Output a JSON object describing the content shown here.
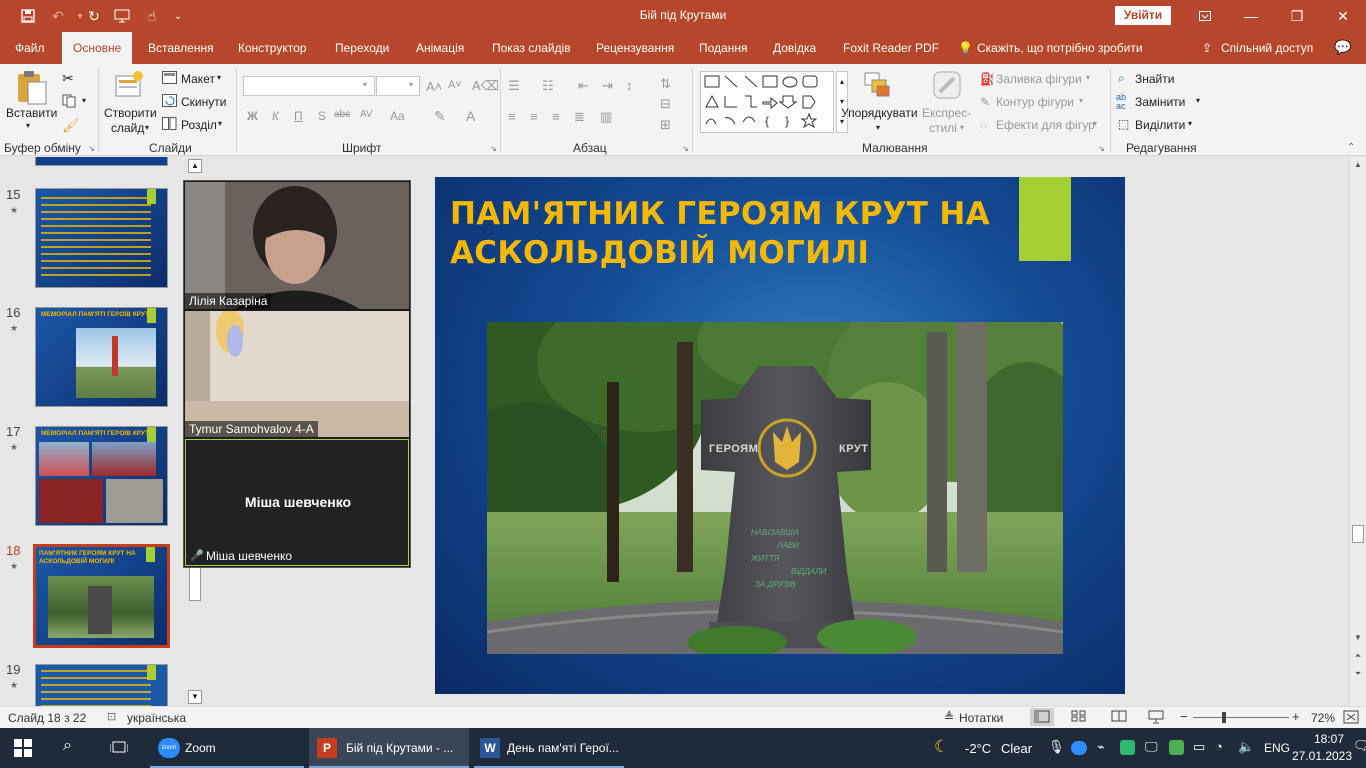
{
  "window": {
    "title": "Бій під Крутами",
    "signin_label": "Увійти"
  },
  "menu": {
    "items": [
      "Файл",
      "Основне",
      "Вставлення",
      "Конструктор",
      "Переходи",
      "Анімація",
      "Показ слайдів",
      "Рецензування",
      "Подання",
      "Довідка",
      "Foxit Reader PDF"
    ],
    "active": "Основне",
    "tell_me": "Скажіть, що потрібно зробити",
    "share": "Спільний доступ"
  },
  "ribbon": {
    "clipboard": {
      "paste": "Вставити",
      "label": "Буфер обміну"
    },
    "slides": {
      "new_slide_1": "Створити",
      "new_slide_2": "слайд",
      "layout": "Макет",
      "reset": "Скинути",
      "section": "Розділ",
      "label": "Слайди"
    },
    "font": {
      "label": "Шрифт",
      "bold": "Ж",
      "italic": "К",
      "underline": "П",
      "strike": "S",
      "strike_abc": "abc",
      "spacing": "AV",
      "case": "Aa"
    },
    "paragraph": {
      "label": "Абзац"
    },
    "drawing": {
      "arrange": "Упорядкувати",
      "quick_styles_1": "Експрес-",
      "quick_styles_2": "стилі",
      "shape_fill": "Заливка фігури",
      "shape_outline": "Контур фігури",
      "shape_effects": "Ефекти для фігур",
      "label": "Малювання"
    },
    "editing": {
      "find": "Знайти",
      "replace": "Замінити",
      "select": "Виділити",
      "label": "Редагування"
    }
  },
  "thumbnails": [
    {
      "num": "15",
      "title": "",
      "active": false
    },
    {
      "num": "16",
      "title": "МЕМОРІАЛ ПАМ'ЯТІ ГЕРОЇВ КРУТ",
      "active": false
    },
    {
      "num": "17",
      "title": "МЕМОРІАЛ ПАМ'ЯТІ ГЕРОЇВ КРУТ",
      "active": false
    },
    {
      "num": "18",
      "title": "ПАМ'ЯТНИК ГЕРОЯМ КРУТ НА АСКОЛЬДОВІЙ МОГИЛІ",
      "active": true
    },
    {
      "num": "19",
      "title": "",
      "active": false
    }
  ],
  "zoom": {
    "participants": [
      {
        "name": "Лілія Казаріна"
      },
      {
        "name": "Tymur Samohvalov 4-A"
      },
      {
        "name": "Міша шевченко",
        "display": "Міша шевченко"
      }
    ]
  },
  "slide": {
    "title_line1": "ПАМ'ЯТНИК ГЕРОЯМ КРУТ НА",
    "title_line2": "АСКОЛЬДОВІЙ МОГИЛІ",
    "monument_left": "ГЕРОЯМ",
    "monument_right": "КРУТ",
    "inscription": [
      "НАВІЗАВШИ",
      "ЛАВИ",
      "ЖИТТЯ",
      "ВІДДАЛИ",
      "ЗА ДРУЗІВ"
    ],
    "title_color": "#f5b800",
    "accent_color": "#a4cf35"
  },
  "status": {
    "slide_info": "Слайд 18 з 22",
    "language": "українська",
    "notes": "Нотатки",
    "zoom": "72%"
  },
  "taskbar": {
    "apps": [
      {
        "label": "Zoom"
      },
      {
        "label": "Бій під Крутами - ..."
      },
      {
        "label": "День пам'яті Герої..."
      }
    ],
    "weather": "-2°C",
    "weather_desc": "Clear",
    "lang": "ENG",
    "time": "18:07",
    "date": "27.01.2023"
  },
  "colors": {
    "accent": "#b7472a",
    "selection": "#c43e1c"
  }
}
